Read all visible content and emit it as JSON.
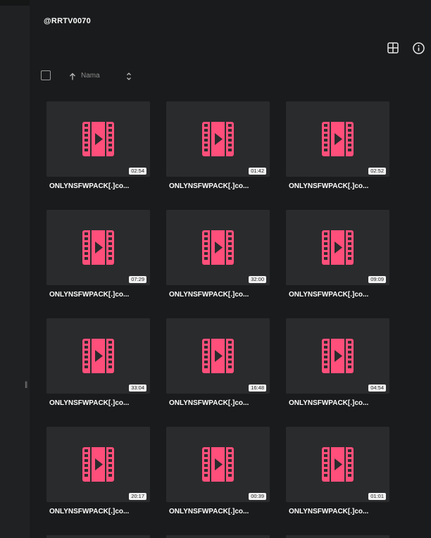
{
  "header": {
    "title": "@RRTV0070",
    "grid_icon": "grid-view-icon",
    "info_icon": "info-icon"
  },
  "toolbar": {
    "sort_label": "Nama",
    "sort_direction_icon": "arrow-up-icon",
    "sort_toggle_icon": "chevron-up-down-icon"
  },
  "theme": {
    "accent": "#ff4f7a",
    "background": "#1a1b1c",
    "card": "#2a2b2d"
  },
  "files": [
    {
      "name": "ONLYNSFWPACK[.]co...",
      "duration": "02:54"
    },
    {
      "name": "ONLYNSFWPACK[.]co...",
      "duration": "01:42"
    },
    {
      "name": "ONLYNSFWPACK[.]co...",
      "duration": "02:52"
    },
    {
      "name": "ONLYNSFWPACK[.]co...",
      "duration": "07:29"
    },
    {
      "name": "ONLYNSFWPACK[.]co...",
      "duration": "32:00"
    },
    {
      "name": "ONLYNSFWPACK[.]co...",
      "duration": "09:09"
    },
    {
      "name": "ONLYNSFWPACK[.]co...",
      "duration": "33:04"
    },
    {
      "name": "ONLYNSFWPACK[.]co...",
      "duration": "16:48"
    },
    {
      "name": "ONLYNSFWPACK[.]co...",
      "duration": "04:54"
    },
    {
      "name": "ONLYNSFWPACK[.]co...",
      "duration": "20:17"
    },
    {
      "name": "ONLYNSFWPACK[.]co...",
      "duration": "00:39"
    },
    {
      "name": "ONLYNSFWPACK[.]co...",
      "duration": "01:01"
    }
  ]
}
